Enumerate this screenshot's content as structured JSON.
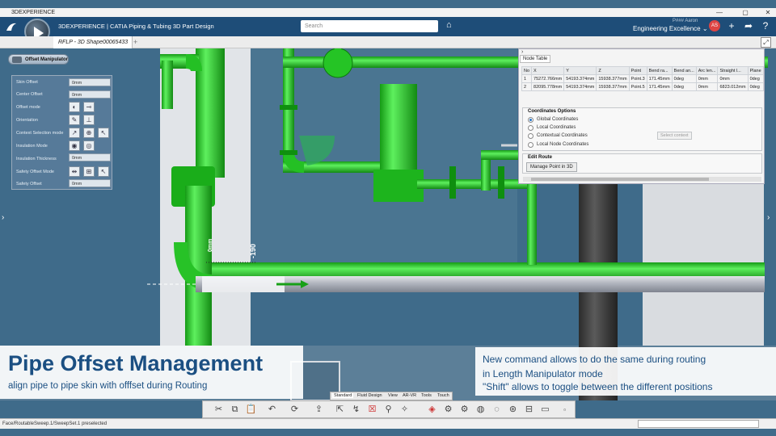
{
  "window": {
    "title": "3DEXPERIENCE",
    "controls": [
      "—",
      "▢",
      "✕"
    ]
  },
  "topbar": {
    "brand": "3DEXPERIENCE | CATIA Piping & Tubing 3D Part Design",
    "search_placeholder": "Search",
    "user": "P### Aaron",
    "workspace": "Engineering Excellence ⌄",
    "avatar_initials": "AS"
  },
  "tabs": {
    "active": "RFLP - 3D Shape00065433"
  },
  "offset_manipulator": {
    "title": "Offset Manipulator",
    "rows": [
      {
        "label": "Skin Offset",
        "value": "0mm"
      },
      {
        "label": "Center Offset",
        "value": "0mm"
      },
      {
        "label": "Offset mode",
        "value": ""
      },
      {
        "label": "Orientation",
        "value": ""
      },
      {
        "label": "Context Selection mode",
        "value": ""
      },
      {
        "label": "Insulation Mode",
        "value": ""
      },
      {
        "label": "Insulation Thickness",
        "value": "0mm"
      },
      {
        "label": "Safety Offset Mode",
        "value": ""
      },
      {
        "label": "Safety Offset",
        "value": "0mm"
      }
    ]
  },
  "node_table": {
    "tab": "Node Table",
    "columns": [
      "No",
      "X",
      "Y",
      "Z",
      "Point",
      "Bend ra...",
      "Bend an...",
      "Arc len...",
      "Straight l...",
      "Plane"
    ],
    "rows": [
      [
        "1",
        "75272.766mm",
        "54193.374mm",
        "15938.377mm",
        "Point.3",
        "171.45mm",
        "0deg",
        "0mm",
        "0mm",
        "0deg"
      ],
      [
        "2",
        "82095.778mm",
        "54193.374mm",
        "15938.377mm",
        "Point.5",
        "171.45mm",
        "0deg",
        "0mm",
        "6823.012mm",
        "0deg"
      ]
    ],
    "coord_title": "Coordinates Options",
    "coord_options": [
      "Global Coordinates",
      "Local Coordinates",
      "Contextual Coordinates",
      "Local Node Coordinates"
    ],
    "selected_option": "Global Coordinates",
    "select_context": "Select context",
    "edit_route_title": "Edit Route",
    "manage_point": "Manage Point in 3D"
  },
  "scene": {
    "dimension_label": "-190",
    "offset_label": "0mm",
    "colors": {
      "pipe": "#22cc22",
      "pipe_dark": "#159a15",
      "grey_pipe": "#a9adb7",
      "background": "#3f6b8a"
    }
  },
  "overlay_left": {
    "title": "Pipe Offset Management",
    "subtitle": "align pipe to pipe skin with offfset during Routing"
  },
  "overlay_right": {
    "line1": "New command allows to do the same during routing",
    "line2": "in Length Manipulator mode",
    "line3": "\"Shift\" allows to toggle between the different positions"
  },
  "workbench_tabs": [
    "Standard",
    "Fluid Design",
    "View",
    "AR-VR",
    "Tools",
    "Touch"
  ],
  "toolbar_icons": [
    "scissors-icon",
    "copy-icon",
    "paste-icon",
    "undo-icon",
    "refresh-icon",
    "export-icon",
    "measure-icon",
    "route-icon",
    "delete-icon",
    "pin-icon",
    "magic-icon",
    "cube-icon",
    "part-icon",
    "assembly-icon",
    "sphere-icon",
    "shape-icon",
    "apply-icon",
    "settings-icon",
    "screen-icon"
  ],
  "status": {
    "text": "Face/RoutableSweep.1/SweepSet.1 preselected"
  }
}
